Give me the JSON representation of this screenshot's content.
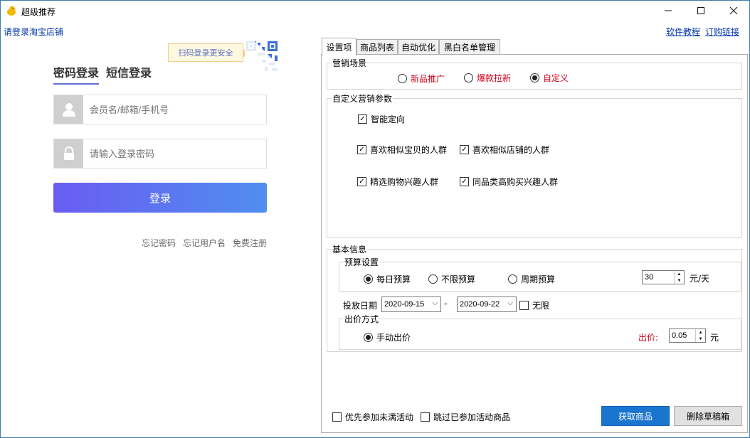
{
  "window": {
    "title": "超级推荐",
    "minimize_glyph": "—",
    "maximize_glyph": "☐",
    "close_glyph": "✕"
  },
  "header": {
    "login_shop_link": "请登录淘宝店铺",
    "tutorial_link": "软件教程",
    "order_link": "订购链接"
  },
  "login": {
    "tab_password": "密码登录",
    "tab_sms": "短信登录",
    "qr_tip": "扫码登录更安全",
    "username_placeholder": "会员名/邮箱/手机号",
    "password_placeholder": "请输入登录密码",
    "login_button": "登录",
    "forgot_password": "忘记密码",
    "forgot_username": "忘记用户名",
    "register": "免费注册"
  },
  "tabs": [
    "设置项",
    "商品列表",
    "自动优化",
    "黑白名单管理"
  ],
  "marketing_scene": {
    "title": "营销场景",
    "options": [
      "新品推广",
      "爆款拉新",
      "自定义"
    ],
    "selected": "自定义"
  },
  "custom_params": {
    "title": "自定义营销参数",
    "smart_targeting": "智能定向",
    "similar_items": "喜欢相似宝贝的人群",
    "similar_shops": "喜欢相似店铺的人群",
    "shopping_interest": "精选购物兴趣人群",
    "category_interest": "同品类高购买兴趣人群"
  },
  "basic_info": {
    "title": "基本信息",
    "budget_title": "预算设置",
    "budget_daily": "每日预算",
    "budget_unlimited": "不限预算",
    "budget_periodic": "周期预算",
    "budget_value": "30",
    "budget_unit": "元/天",
    "date_label": "投放日期",
    "start_date": "2020-09-15",
    "date_sep": "-",
    "end_date": "2020-09-22",
    "unlimited_label": "无限",
    "bid_title": "出价方式",
    "bid_manual": "手动出价",
    "bid_label": "出价:",
    "bid_value": "0.05",
    "bid_unit": "元"
  },
  "footer": {
    "prefer_unfull": "优先参加未满活动",
    "skip_joined": "跳过已参加活动商品",
    "fetch_button": "获取商品",
    "delete_drafts_button": "删除草稿箱"
  },
  "colors": {
    "accent_blue": "#1a75cf",
    "link_blue": "#0033aa",
    "red_text": "#d0021b",
    "login_gradient_start": "#6a5cf2",
    "login_gradient_end": "#4f8ef0"
  }
}
